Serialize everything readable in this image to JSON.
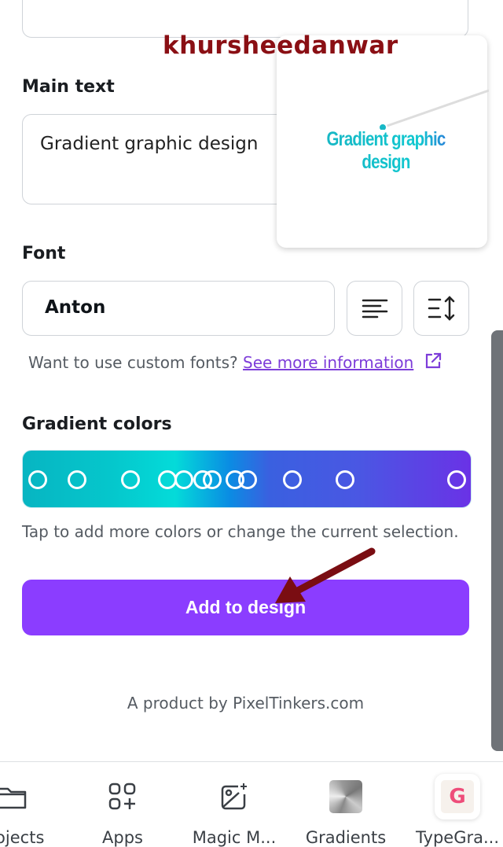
{
  "watermark": "khursheedanwar",
  "main_text": {
    "label": "Main text",
    "value": "Gradient graphic design"
  },
  "preview": {
    "text": "Gradient graphic design"
  },
  "font": {
    "label": "Font",
    "value": "Anton",
    "align_icon": "align-left-icon",
    "spacing_icon": "line-spacing-icon"
  },
  "custom_fonts": {
    "text": "Want to use custom fonts?",
    "link": "See more information",
    "icon": "external-link-icon"
  },
  "gradient": {
    "label": "Gradient colors",
    "colors": [
      "#07b5c2",
      "#04dbd9",
      "#0a8de3",
      "#4a57e3",
      "#6a32e6"
    ],
    "stops_count": 12,
    "hint": "Tap to add more colors or change the current selection."
  },
  "add_button": "Add to design",
  "accent": "#8b3dff",
  "footer": "A product by PixelTinkers.com",
  "nav": [
    {
      "label": "Projects",
      "icon": "folder-icon"
    },
    {
      "label": "Apps",
      "icon": "apps-icon"
    },
    {
      "label": "Magic M...",
      "icon": "magic-media-icon"
    },
    {
      "label": "Gradients",
      "icon": "gradients-icon"
    },
    {
      "label": "TypeGra...",
      "icon": "typegradient-icon"
    }
  ]
}
